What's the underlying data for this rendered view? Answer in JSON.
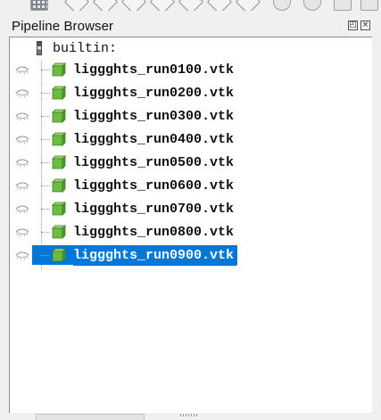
{
  "panel": {
    "title": "Pipeline Browser",
    "float_button_glyph": "◰",
    "close_button_glyph": "×"
  },
  "tree": {
    "root_label": "builtin:",
    "items": [
      {
        "label": "liggghts_run0100.vtk",
        "visible_icon": "eye-closed-icon",
        "selected": false
      },
      {
        "label": "liggghts_run0200.vtk",
        "visible_icon": "eye-closed-icon",
        "selected": false
      },
      {
        "label": "liggghts_run0300.vtk",
        "visible_icon": "eye-closed-icon",
        "selected": false
      },
      {
        "label": "liggghts_run0400.vtk",
        "visible_icon": "eye-closed-icon",
        "selected": false
      },
      {
        "label": "liggghts_run0500.vtk",
        "visible_icon": "eye-closed-icon",
        "selected": false
      },
      {
        "label": "liggghts_run0600.vtk",
        "visible_icon": "eye-closed-icon",
        "selected": false
      },
      {
        "label": "liggghts_run0700.vtk",
        "visible_icon": "eye-closed-icon",
        "selected": false
      },
      {
        "label": "liggghts_run0800.vtk",
        "visible_icon": "eye-closed-icon",
        "selected": false
      },
      {
        "label": "liggghts_run0900.vtk",
        "visible_icon": "eye-closed-icon",
        "selected": true
      }
    ]
  },
  "colors": {
    "selection": "#0078d7",
    "cube_green": "#6cbd3f",
    "background": "#f0f0f0"
  }
}
